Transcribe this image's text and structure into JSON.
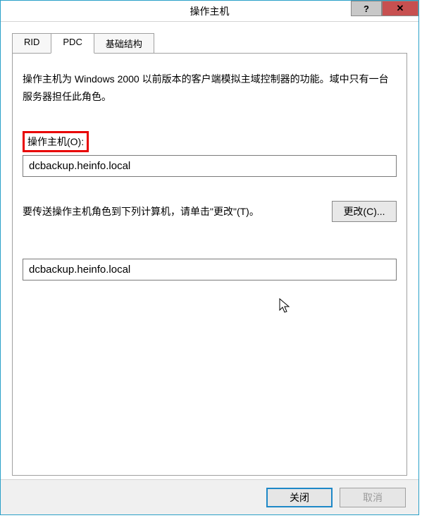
{
  "window": {
    "title": "操作主机"
  },
  "tabs": {
    "rid": "RID",
    "pdc": "PDC",
    "infra": "基础结构"
  },
  "panel": {
    "description": "操作主机为 Windows 2000 以前版本的客户端模拟主域控制器的功能。域中只有一台服务器担任此角色。",
    "operations_master_label": "操作主机(O):",
    "operations_master_value": "dcbackup.heinfo.local",
    "transfer_text": "要传送操作主机角色到下列计算机，请单击\"更改\"(T)。",
    "change_button": "更改(C)...",
    "target_value": "dcbackup.heinfo.local"
  },
  "footer": {
    "close": "关闭",
    "cancel": "取消"
  }
}
